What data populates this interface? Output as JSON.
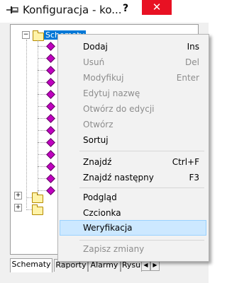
{
  "window": {
    "title": "Konfiguracja - ko...",
    "help_label": "?",
    "close_label": "✕"
  },
  "tree": {
    "root_label": "Schematy",
    "root_expander": "−",
    "collapsed_expander": "+"
  },
  "tabs": [
    {
      "label": "Schematy",
      "active": true
    },
    {
      "label": "Raporty",
      "active": false
    },
    {
      "label": "Alarmy",
      "active": false
    },
    {
      "label": "Rysu",
      "active": false
    }
  ],
  "tab_scroll": {
    "left": "◀",
    "right": "▶"
  },
  "context_menu": {
    "items": [
      {
        "label": "Dodaj",
        "shortcut": "Ins",
        "enabled": true
      },
      {
        "label": "Usuń",
        "shortcut": "Del",
        "enabled": false
      },
      {
        "label": "Modyfikuj",
        "shortcut": "Enter",
        "enabled": false
      },
      {
        "label": "Edytuj nazwę",
        "shortcut": "",
        "enabled": false
      },
      {
        "label": "Otwórz do edycji",
        "shortcut": "",
        "enabled": false
      },
      {
        "label": "Otwórz",
        "shortcut": "",
        "enabled": false
      },
      {
        "label": "Sortuj",
        "shortcut": "",
        "enabled": true
      },
      {
        "label": "Znajdź",
        "shortcut": "Ctrl+F",
        "enabled": true
      },
      {
        "label": "Znajdź następny",
        "shortcut": "F3",
        "enabled": true
      },
      {
        "label": "Podgląd",
        "shortcut": "",
        "enabled": true
      },
      {
        "label": "Czcionka",
        "shortcut": "",
        "enabled": true
      },
      {
        "label": "Weryfikacja",
        "shortcut": "",
        "enabled": true,
        "highlighted": true
      },
      {
        "label": "Zapisz zmiany",
        "shortcut": "",
        "enabled": false
      }
    ]
  }
}
